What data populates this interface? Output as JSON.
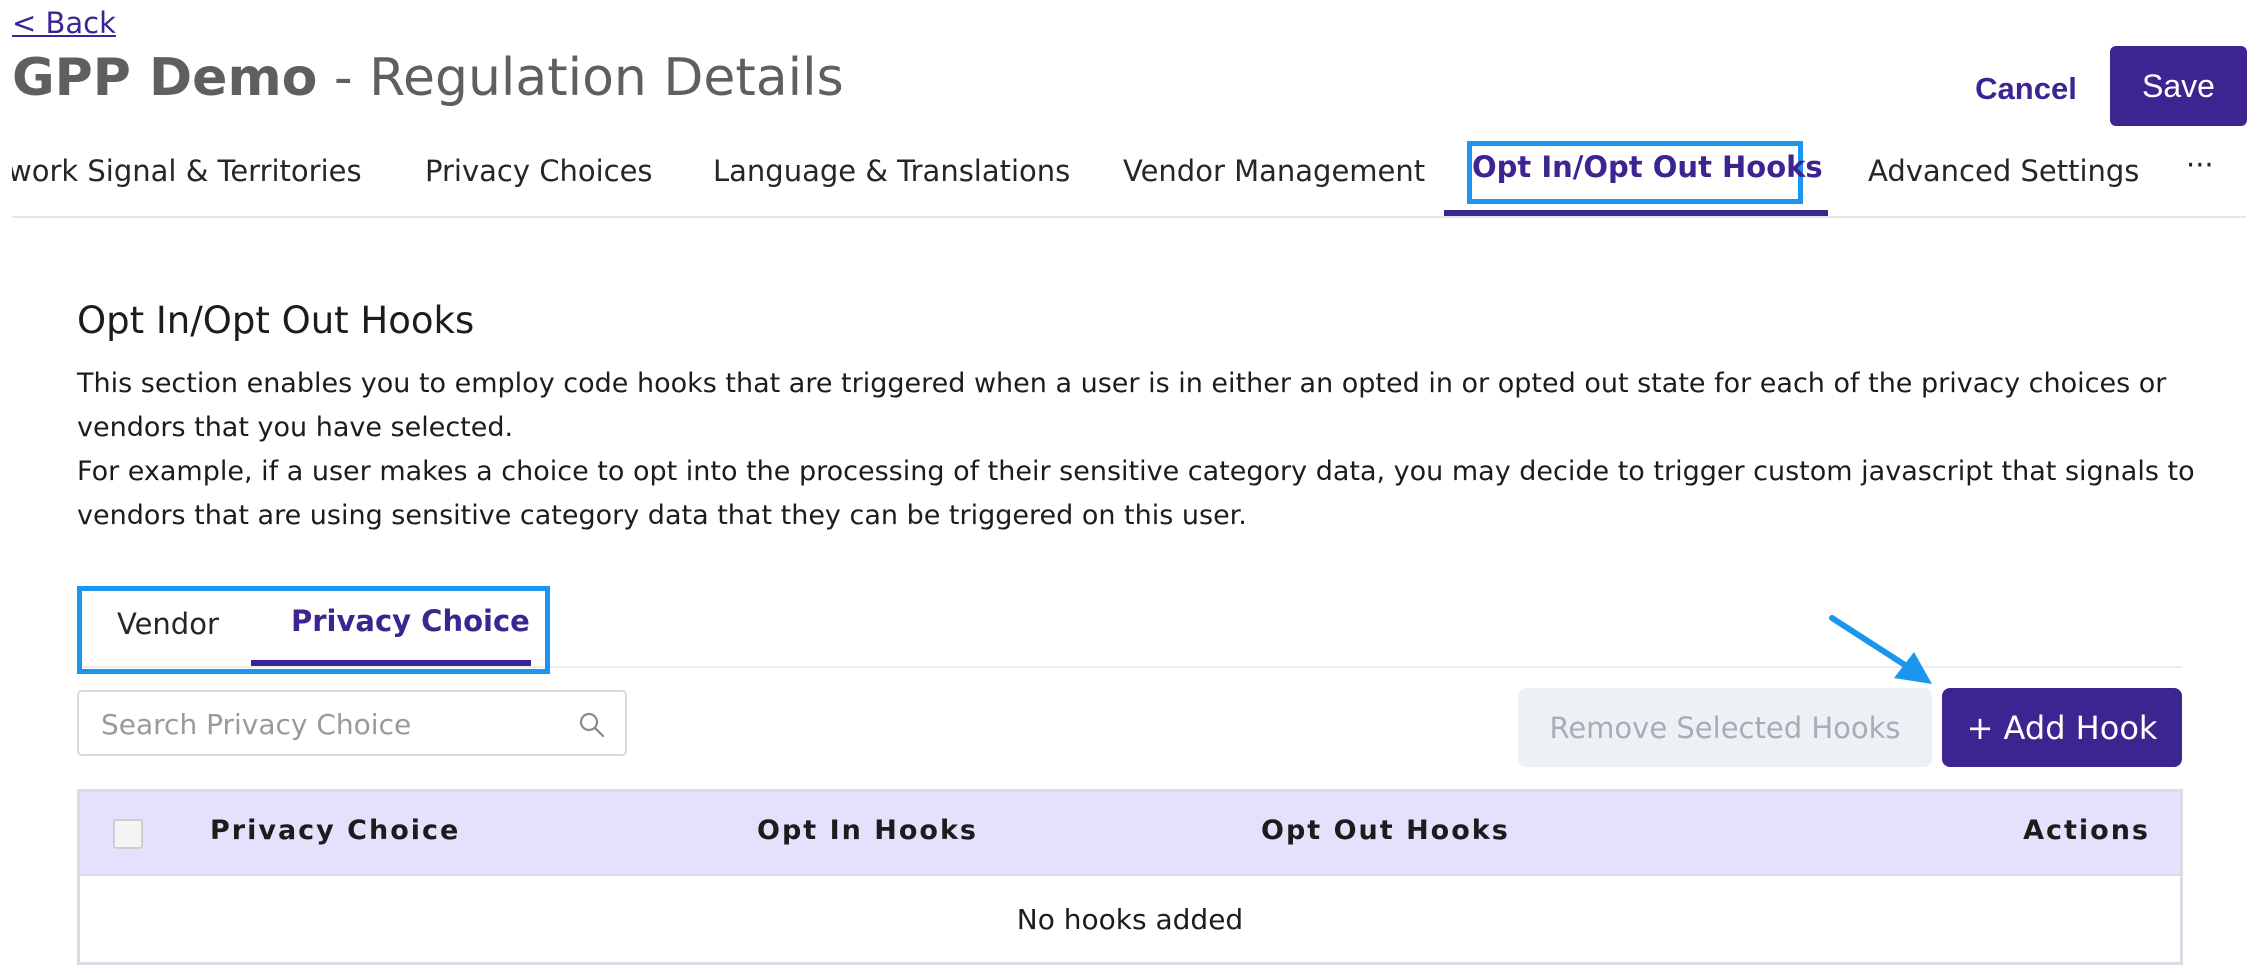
{
  "header": {
    "back_label": "< Back",
    "title_strong": "GPP Demo",
    "title_rest": " - Regulation Details",
    "cancel_label": "Cancel",
    "save_label": "Save"
  },
  "tabs": [
    {
      "label": "work Signal & Territories"
    },
    {
      "label": "Privacy Choices"
    },
    {
      "label": "Language & Translations"
    },
    {
      "label": "Vendor Management"
    },
    {
      "label": "Opt In/Opt Out Hooks",
      "active": true
    },
    {
      "label": "Advanced Settings"
    },
    {
      "label": "···"
    }
  ],
  "section": {
    "title": "Opt In/Opt Out Hooks",
    "paragraph1": "This section enables you to employ code hooks that are triggered when a user is in either an opted in or opted out state for each of the privacy choices or vendors that you have selected.",
    "paragraph2": "For example, if a user makes a choice to opt into the processing of their sensitive category data, you may decide to trigger custom javascript that signals to vendors that are using sensitive category data that they can be triggered on this user."
  },
  "subtabs": [
    {
      "label": "Vendor"
    },
    {
      "label": "Privacy Choice",
      "active": true
    }
  ],
  "search": {
    "placeholder": "Search Privacy Choice",
    "value": ""
  },
  "actions": {
    "remove_label": "Remove Selected Hooks",
    "add_label": "+ Add Hook"
  },
  "table": {
    "columns": [
      "Privacy Choice",
      "Opt In Hooks",
      "Opt Out Hooks",
      "Actions"
    ],
    "rows": [],
    "empty_message": "No hooks added"
  },
  "colors": {
    "brand": "#3d2591",
    "highlight": "#1a96ee",
    "header_bg": "#e6e0fc",
    "disabled_bg": "#edf0f4"
  },
  "icons": [
    "search-icon",
    "annotation-arrow-icon",
    "more-icon"
  ]
}
